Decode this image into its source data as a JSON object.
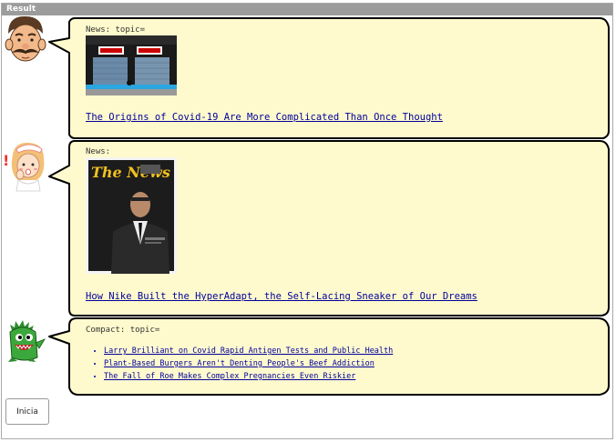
{
  "window": {
    "title": "Result"
  },
  "messages": [
    {
      "avatar": "man-mustache-icon",
      "label": "News: topic=",
      "image": "storefront-photo",
      "headline": "The Origins of Covid-19 Are More Complicated Than Once Thought"
    },
    {
      "avatar": "nurse-girl-icon",
      "label": "News:",
      "image": "magazine-cover",
      "cover_title": "The News",
      "headline": "How Nike Built the HyperAdapt, the Self-Lacing Sneaker of Our Dreams"
    },
    {
      "avatar": "green-monster-icon",
      "label": "Compact: topic=",
      "items": [
        "Larry Brilliant on Covid Rapid Antigen Tests and Public Health",
        "Plant-Based Burgers Aren't Denting People's Beef Addiction",
        "The Fall of Roe Makes Complex Pregnancies Even Riskier"
      ]
    }
  ],
  "actions": {
    "init_label": "Inicia"
  },
  "colors": {
    "bubble_fill": "#fffacd",
    "bubble_stroke": "#000000",
    "link": "#00009c",
    "title_bar": "#9c9c9c"
  }
}
